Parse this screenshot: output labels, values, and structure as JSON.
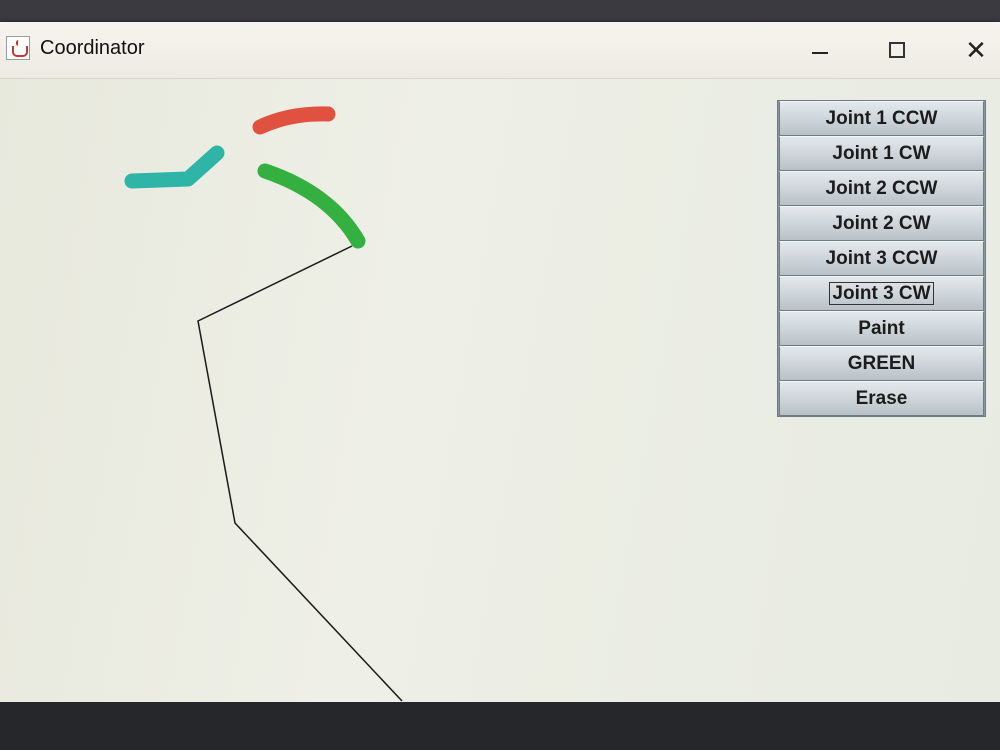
{
  "window": {
    "title": "Coordinator",
    "controls": {
      "minimize": "—",
      "maximize": "☐",
      "close": "✕"
    }
  },
  "buttons": [
    {
      "label": "Joint 1 CCW",
      "focused": false
    },
    {
      "label": "Joint 1 CW",
      "focused": false
    },
    {
      "label": "Joint 2 CCW",
      "focused": false
    },
    {
      "label": "Joint 2 CW",
      "focused": false
    },
    {
      "label": "Joint 3 CCW",
      "focused": false
    },
    {
      "label": "Joint 3 CW",
      "focused": true
    },
    {
      "label": "Paint",
      "focused": false
    },
    {
      "label": "GREEN",
      "focused": false
    },
    {
      "label": "Erase",
      "focused": false
    }
  ],
  "colors": {
    "paint_red": "#e0523f",
    "paint_green": "#33b040",
    "paint_teal": "#2eb5a8",
    "arm_line": "#1a1a1a",
    "canvas_bg": "#e9eadf"
  },
  "icons": {
    "app": "java-coffee-cup-icon"
  }
}
